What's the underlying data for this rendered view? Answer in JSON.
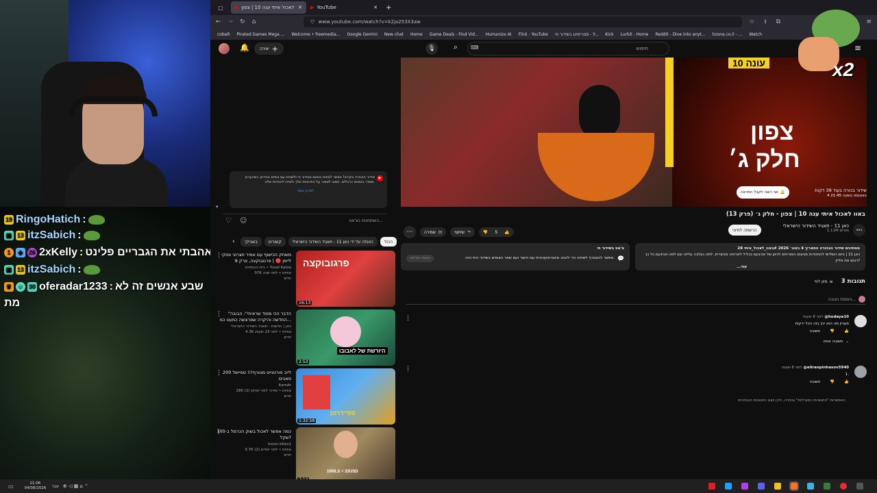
{
  "stream": {
    "chat": [
      {
        "level": "19",
        "user": "RingoHatich",
        "user_color": "#a6d8ff",
        "message": "",
        "emote": true
      },
      {
        "level": "13",
        "user": "itzSabich",
        "user_color": "#a6d8ff",
        "message": "",
        "emote": true
      },
      {
        "level": "26",
        "user": "2xKelly",
        "user_color": "#ffffff",
        "message": "אהבתי את הגבריים פלינט",
        "emote": false
      },
      {
        "level": "13",
        "user": "itzSabich",
        "user_color": "#a6d8ff",
        "message": "",
        "emote": true
      },
      {
        "level": "30",
        "user": "oferadar1233",
        "user_color": "#ffffff",
        "message": "שבע אנשים זה לא",
        "emote": false
      }
    ],
    "chat_continuation": "מת",
    "overlay_x2": "x2"
  },
  "browser": {
    "tabs": [
      {
        "label": "באוו לאכול איתי ענה 10 | צפון",
        "active": true
      },
      {
        "label": "YouTube",
        "active": false
      }
    ],
    "new_tab": "+",
    "url": "www.youtube.com/watch?v=k2ja253X3aw",
    "bookmarks": [
      "cobalt",
      "Pirated Games Mega ...",
      "Welcome • freemedia...",
      "Google Gemini",
      "New chat",
      "Home",
      "Game Deals - Find Vid...",
      "Humanize AI",
      "Flint - YouTube",
      "סטרימינג בשידור חי - Y...",
      "Kick",
      "Lurkit - Home",
      "Reddit - Dive into anyt...",
      "hzone.co.il - ...",
      "Watch"
    ]
  },
  "youtube": {
    "create_label": "יצירה",
    "search_placeholder": "חיפוש",
    "player_overlay": {
      "top_label": "עונה 10",
      "title_line1": "צפון",
      "title_line2": "חלק ג׳",
      "premiere": "שידור בכורה בעוד 39 דקות",
      "premiere_date": "4 באוגוסט בשעה 21:45",
      "notify": "אני רוצה לקבל התראה"
    },
    "chat_notice": "שידור הבכורה בקרוב! אפשר לצפות בנאום בשידור חי ולשוחח עם צופים אחרים, כשהערוץ משדר בזמנים הרגילים. חשוב לשמור על הפרטיות שלך ולציית להנחיות שלנו.",
    "chat_notice_link": "למידע נוסף",
    "chat_input_placeholder": "השתתפות בצ'אט...",
    "chips": [
      "הכול",
      "הועלה על ידי כאן 11 - תאגיד השידור הישראלי",
      "קשורים",
      "בשבילך"
    ],
    "related": [
      {
        "title": "משחק הכישוף עם אמיר חצרוני ומוקי ליימן 🔴 | פרגובוקצה, פרק 9",
        "channel": "בית הבמאים • Yuval Katza",
        "views": "97K צפיות • לפני שנה",
        "badge": "חדש",
        "duration": "16:13",
        "thumb_text": "פרגובוקצה"
      },
      {
        "title": "\"הדבר הכי מפוד שראיתי\": הבובה החדשה והיקרה שפרצשה כמעט כמ...",
        "channel": "כאן | חדשות - תאגיד השידור הישראלי",
        "views": "4.3K צפיות • לפני 23 שעות",
        "badge": "חדש",
        "duration": "2:53",
        "thumb_text": "היורשת של לאבובו"
      },
      {
        "title": "לייב פורטנייט מטורף!!! ספיישל 200 סאבים",
        "channel": "ItamAr",
        "views": "280 צפיות • שידור לפני יומיים (2)",
        "badge": "חדש",
        "duration": "1:32:58",
        "thumb_text": "ספיידרמן"
      },
      {
        "title": "כמה אפשר לאכול בשוק הכרמל ב-100 שקל?",
        "channel": "moon.bites1",
        "views": "3.7K צפיות • לפני יומיים (2)",
        "badge": "חדש",
        "duration": "7:12",
        "thumb_text": "100ILS = 33USD"
      }
    ],
    "video_title": "באוו לאכול איתי ענה 10 | צפון - חלק ג׳ (פרק 13)",
    "channel_name": "כאן 11 - תאגיד השידור הישראלי",
    "subscribers": "1.11M מנויים",
    "join_label": "באוו",
    "subscribe_label": "הרשמה למינוי",
    "likes": "5",
    "share_label": "שיתוף",
    "save_label": "שמירה",
    "description_meta": "28 ממתינים  שידור הבכורה התאריך 4 באוג׳ 2026  #באוו_לאכול_איתי",
    "description": "כאן 11 | ביום השלישי להתחרות מגיעים האורחים לכיוון של אבינעם בכליל לארוחה מבשרית. למה נעלבה עליזה וגם למה אבינעם כל כך רוגש את אליין?",
    "description_more": "...עוד",
    "live_box_title": "צ'אט בשידור חי",
    "live_box_text": "אפשר להצטרף לשיחה כדי להגיב אינטראקטיבית עם היוצר ועם שאר הצופים בשידור החי הזה.",
    "live_box_button": "הצגת הצ'אט",
    "comments_count": "3 תגובות",
    "sort_label": "מיון לפי",
    "add_comment": "הוספת תגובה...",
    "comments": [
      {
        "author": "@hodaya10",
        "time": "לפני 8 שעות",
        "text": "מעניין מה הוא יכין בזה הכל ירקות",
        "reply": "תשובה",
        "replies_label": "תשובה אחת"
      },
      {
        "author": "@eliranpinhasov5940",
        "time": "לפני 8 שעות",
        "text": "1.",
        "reply": "תשובה",
        "replies_label": ""
      }
    ],
    "comments_footer": "האפשרות \"התגובות המובילות\" נבחרה, ולכן יוצגו התגובות הנבחרות"
  },
  "taskbar": {
    "time": "21:06",
    "date": "04/08/2026",
    "lang": "עבר"
  }
}
